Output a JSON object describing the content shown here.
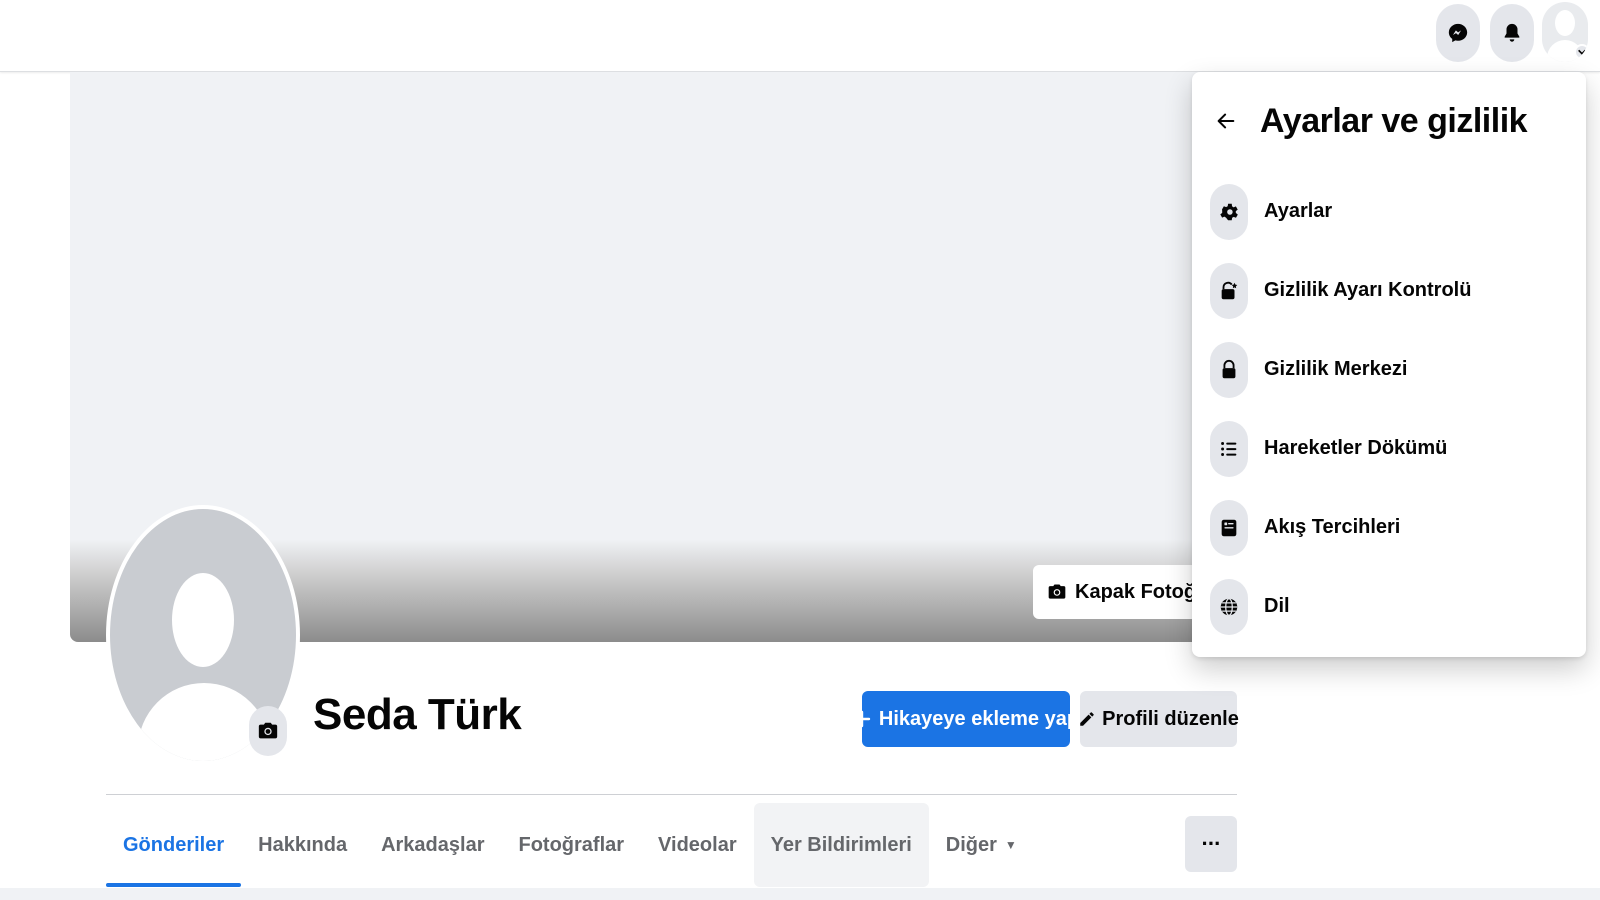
{
  "topbar": {
    "icons": [
      "messenger-icon",
      "bell-icon",
      "avatar-icon",
      "chevron-down-icon"
    ]
  },
  "cover": {
    "button_label": "Kapak Fotoğrafı"
  },
  "profile": {
    "name": "Seda Türk",
    "add_story_label": "Hikayeye ekleme yap",
    "edit_profile_label": "Profili düzenle"
  },
  "tabs": [
    {
      "label": "Gönderiler",
      "active": true
    },
    {
      "label": "Hakkında"
    },
    {
      "label": "Arkadaşlar"
    },
    {
      "label": "Fotoğraflar"
    },
    {
      "label": "Videolar"
    },
    {
      "label": "Yer Bildirimleri"
    },
    {
      "label": "Diğer"
    }
  ],
  "more_button_label": "···",
  "menu": {
    "title": "Ayarlar ve gizlilik",
    "items": [
      {
        "label": "Ayarlar",
        "icon": "gear-icon"
      },
      {
        "label": "Gizlilik Ayarı Kontrolü",
        "icon": "lock-check-icon"
      },
      {
        "label": "Gizlilik Merkezi",
        "icon": "lock-icon"
      },
      {
        "label": "Hareketler Dökümü",
        "icon": "list-icon"
      },
      {
        "label": "Akış Tercihleri",
        "icon": "feed-icon"
      },
      {
        "label": "Dil",
        "icon": "globe-icon"
      }
    ]
  },
  "colors": {
    "accent": "#1b74e4",
    "button_gray": "#e4e6eb",
    "text_secondary": "#65676b"
  }
}
